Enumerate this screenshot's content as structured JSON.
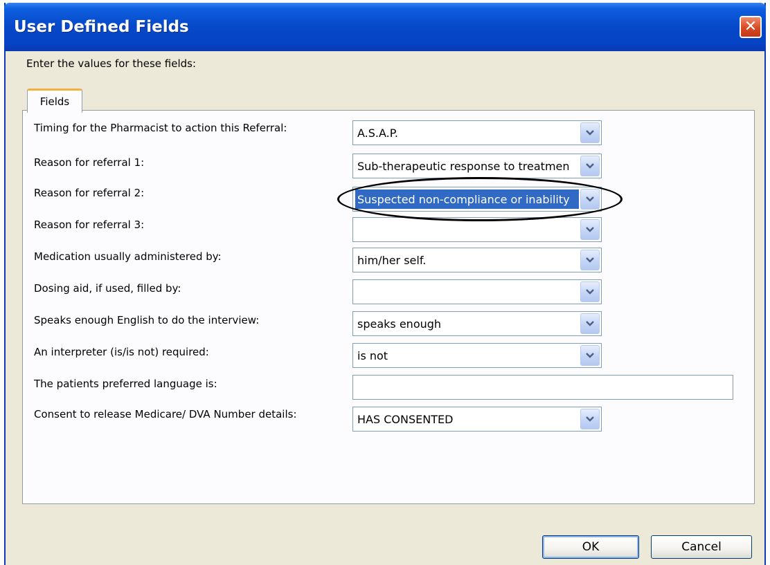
{
  "window": {
    "title": "User Defined Fields",
    "close_glyph": "✕"
  },
  "instruction": "Enter the values for these fields:",
  "tabs": [
    {
      "label": "Fields"
    }
  ],
  "fields": [
    {
      "label": "Timing for the Pharmacist to action this Referral:",
      "value": "A.S.A.P.",
      "type": "combo"
    },
    {
      "label": "Reason for referral 1:",
      "value": "Sub-therapeutic response to treatmen",
      "type": "combo"
    },
    {
      "label": "Reason for referral 2:",
      "value": "Suspected non-compliance or inability",
      "type": "combo",
      "selected": true
    },
    {
      "label": "Reason for referral 3:",
      "value": "",
      "type": "combo"
    },
    {
      "label": "Medication usually administered by:",
      "value": "him/her self.",
      "type": "combo"
    },
    {
      "label": "Dosing aid, if used, filled by:",
      "value": "",
      "type": "combo"
    },
    {
      "label": "Speaks enough English to do the interview:",
      "value": "speaks enough",
      "type": "combo"
    },
    {
      "label": "An interpreter (is/is not) required:",
      "value": "is not",
      "type": "combo"
    },
    {
      "label": "The patients preferred language is:",
      "value": "",
      "type": "text"
    },
    {
      "label": "Consent to release Medicare/ DVA  Number details:",
      "value": "HAS CONSENTED",
      "type": "combo"
    }
  ],
  "buttons": {
    "ok": "OK",
    "cancel": "Cancel"
  },
  "colors": {
    "title_bar": "#0648c8",
    "selection": "#316ac5",
    "close_button": "#d64a22",
    "tab_accent": "#f3b03a"
  },
  "icons": {
    "dropdown": "chevron-down-icon",
    "close": "close-icon"
  }
}
